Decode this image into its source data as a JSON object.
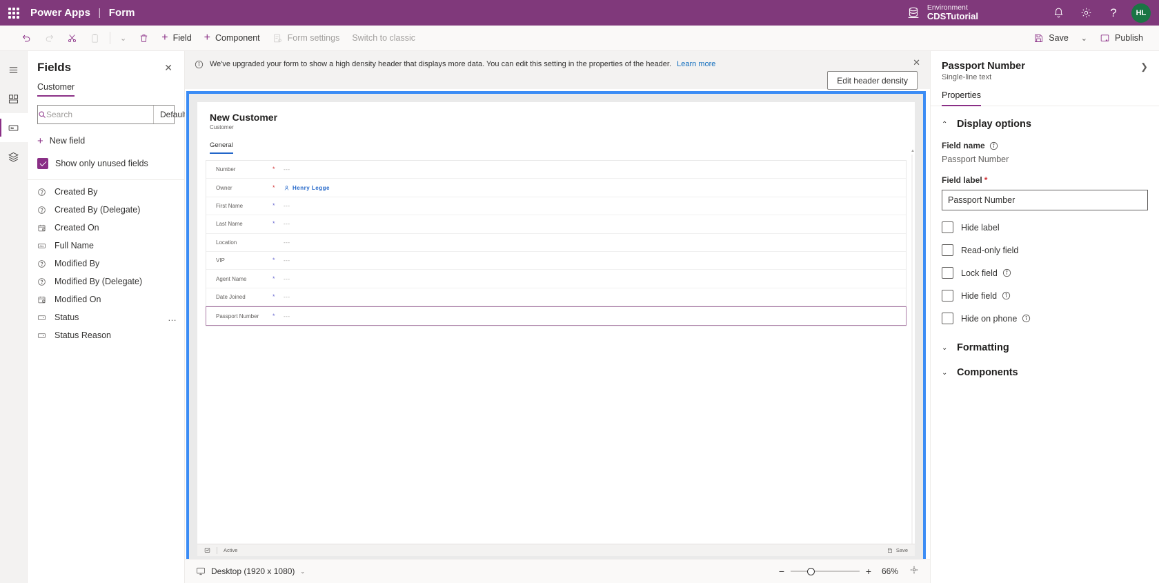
{
  "suitebar": {
    "waffle_icon": "app-launcher-icon",
    "brand": "Power Apps",
    "separator": "|",
    "app_name": "Form",
    "environment_label": "Environment",
    "environment_name": "CDSTutorial",
    "environment_icon": "environment-icon",
    "notifications_icon": "bell-icon",
    "settings_icon": "gear-icon",
    "help_icon": "help-icon",
    "help_glyph": "?",
    "avatar_initials": "HL",
    "brand_color": "#80397b",
    "avatar_color": "#1a7544"
  },
  "commandbar": {
    "undo": "Undo",
    "redo": "Redo",
    "cut": "Cut",
    "paste": "Paste",
    "paste_chevron": "⌄",
    "delete": "Delete",
    "field": "Field",
    "component": "Component",
    "form_settings": "Form settings",
    "switch_to_classic": "Switch to classic",
    "save": "Save",
    "save_chevron": "⌄",
    "publish": "Publish",
    "accent_color": "#8a2f86"
  },
  "rail": {
    "items": [
      {
        "name": "menu",
        "icon": "hamburger-icon"
      },
      {
        "name": "components",
        "icon": "components-icon"
      },
      {
        "name": "fields",
        "icon": "fields-icon",
        "active": true
      },
      {
        "name": "layers",
        "icon": "layers-icon"
      }
    ]
  },
  "fields_panel": {
    "title": "Fields",
    "close_icon": "close-icon",
    "tab": "Customer",
    "search": {
      "placeholder": "Search",
      "value": "",
      "icon": "search-icon",
      "filter_label": "Default",
      "filter_chevron": "⌄"
    },
    "new_field": "New field",
    "show_only_unused": {
      "label": "Show only unused fields",
      "checked": true
    },
    "items": [
      {
        "label": "Created By",
        "icon": "lookup-icon"
      },
      {
        "label": "Created By (Delegate)",
        "icon": "lookup-icon"
      },
      {
        "label": "Created On",
        "icon": "datetime-icon"
      },
      {
        "label": "Full Name",
        "icon": "text-icon"
      },
      {
        "label": "Modified By",
        "icon": "lookup-icon"
      },
      {
        "label": "Modified By (Delegate)",
        "icon": "lookup-icon"
      },
      {
        "label": "Modified On",
        "icon": "datetime-icon"
      },
      {
        "label": "Status",
        "icon": "choice-icon",
        "overflow": "…"
      },
      {
        "label": "Status Reason",
        "icon": "choice-icon"
      }
    ]
  },
  "notice": {
    "icon": "info-icon",
    "text": "We've upgraded your form to show a high density header that displays more data. You can edit this setting in the properties of the header.",
    "link": "Learn more",
    "close_icon": "close-icon",
    "button": "Edit header density"
  },
  "form_preview": {
    "selection_color": "#3b8cf5",
    "header_title": "New Customer",
    "header_subtitle": "Customer",
    "tab": "General",
    "rows": [
      {
        "label": "Number",
        "required": "*",
        "required_color": "red",
        "value": "---",
        "type": "text"
      },
      {
        "label": "Owner",
        "required": "*",
        "required_color": "red",
        "value": "Henry Legge",
        "type": "person",
        "icon": "person-icon"
      },
      {
        "label": "First Name",
        "required": "*",
        "required_color": "blue",
        "value": "---",
        "type": "text"
      },
      {
        "label": "Last Name",
        "required": "*",
        "required_color": "blue",
        "value": "---",
        "type": "text"
      },
      {
        "label": "Location",
        "required": "",
        "required_color": "",
        "value": "---",
        "type": "text"
      },
      {
        "label": "VIP",
        "required": "*",
        "required_color": "blue",
        "value": "---",
        "type": "text"
      },
      {
        "label": "Agent Name",
        "required": "*",
        "required_color": "blue",
        "value": "---",
        "type": "text"
      },
      {
        "label": "Date Joined",
        "required": "*",
        "required_color": "blue",
        "value": "---",
        "type": "text"
      },
      {
        "label": "Passport Number",
        "required": "*",
        "required_color": "blue",
        "value": "---",
        "type": "text",
        "selected": true
      }
    ],
    "footer": {
      "status_icon": "status-icon",
      "status": "Active",
      "save_icon": "save-icon",
      "save": "Save"
    }
  },
  "zoombar": {
    "device_icon": "monitor-icon",
    "device": "Desktop (1920 x 1080)",
    "device_chevron": "⌄",
    "minus": "−",
    "plus": "+",
    "zoom_percent": "66%",
    "fit_icon": "fit-to-screen-icon"
  },
  "properties": {
    "title": "Passport Number",
    "subtitle": "Single-line text",
    "expand_icon": "chevron-right-icon",
    "tab": "Properties",
    "display_options": {
      "chevron": "⌃",
      "label": "Display options",
      "field_name_label": "Field name",
      "field_name_info": "info-icon",
      "field_name_value": "Passport Number",
      "field_label_label": "Field label",
      "field_label_required": "*",
      "field_label_value": "Passport Number",
      "checkboxes": [
        {
          "label": "Hide label",
          "checked": false,
          "info": false
        },
        {
          "label": "Read-only field",
          "checked": false,
          "info": false
        },
        {
          "label": "Lock field",
          "checked": false,
          "info": true
        },
        {
          "label": "Hide field",
          "checked": false,
          "info": true
        },
        {
          "label": "Hide on phone",
          "checked": false,
          "info": true
        }
      ]
    },
    "formatting": {
      "chevron": "⌄",
      "label": "Formatting"
    },
    "components": {
      "chevron": "⌄",
      "label": "Components"
    },
    "accent_color": "#8a2f86"
  }
}
